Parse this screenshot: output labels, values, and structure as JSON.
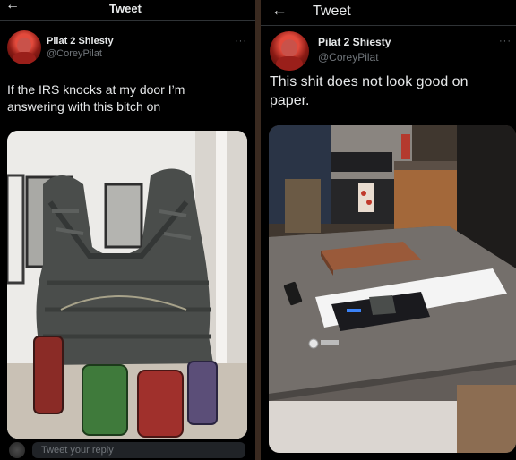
{
  "left": {
    "header": {
      "title": "Tweet",
      "back_icon": "arrow-left-icon"
    },
    "author": {
      "name": "Pilat 2 Shiesty",
      "handle": "@CoreyPilat",
      "more": "···"
    },
    "tweet_text_line1": "If the IRS knocks at my door I’m",
    "tweet_text_line2": "answering with this bitch on",
    "reply": {
      "placeholder": "Tweet your reply"
    }
  },
  "right": {
    "header": {
      "title": "Tweet",
      "back_icon": "arrow-left-icon"
    },
    "author": {
      "name": "Pilat 2 Shiesty",
      "handle": "@CoreyPilat",
      "more": "···"
    },
    "tweet_text_line1": "This shit does not look good on",
    "tweet_text_line2": "paper."
  },
  "colors": {
    "background": "#000000",
    "text": "#e7e9ea",
    "secondary": "#71767b",
    "divider": "#3a2a20"
  }
}
